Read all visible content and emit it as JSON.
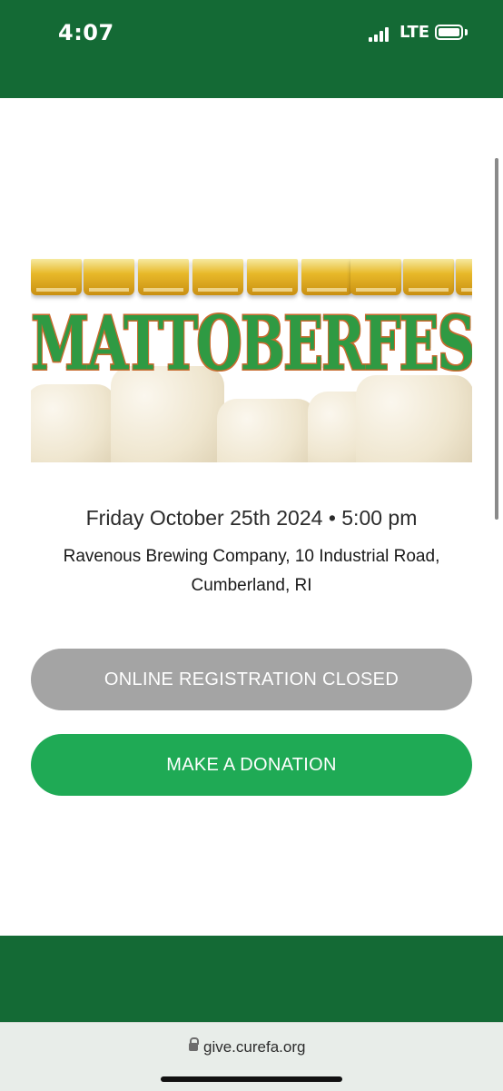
{
  "status_bar": {
    "time": "4:07",
    "network": "LTE",
    "signal_bars": 4,
    "battery_level": 1.0
  },
  "banner": {
    "title": "MATTOBERFEST",
    "title_color": "#2f9a43",
    "outline_color": "#c96b2f"
  },
  "event": {
    "date_time": "Friday October 25th 2024 • 5:00 pm",
    "venue": "Ravenous Brewing Company, 10 Industrial Road, Cumberland, RI"
  },
  "buttons": {
    "registration_label": "ONLINE REGISTRATION CLOSED",
    "donation_label": "MAKE A DONATION"
  },
  "browser": {
    "url": "give.curefa.org",
    "lock_icon": "lock-icon"
  },
  "colors": {
    "brand_green": "#146a35",
    "donate_green": "#1faa55",
    "disabled_gray": "#a4a4a4"
  }
}
